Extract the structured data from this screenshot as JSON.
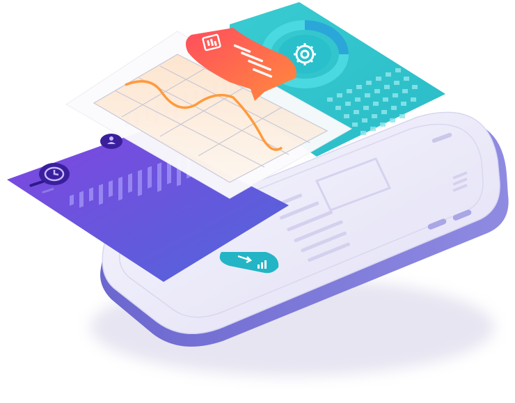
{
  "illustration": {
    "kind": "isometric mobile dashboard illustration",
    "panels": [
      {
        "name": "phone-device",
        "color": "#eceaf8",
        "edge_color": "#7b78d6"
      },
      {
        "name": "teal-analytics-card",
        "color": "#27c2cc",
        "icon": "gear-icon",
        "widget": "donut-ring"
      },
      {
        "name": "purple-stats-card",
        "color": "#6a4ad6",
        "icons": [
          "clock-icon",
          "user-icon"
        ]
      },
      {
        "name": "line-chart-card",
        "color": "#fafafa",
        "curve_color": "#ff9a3c"
      },
      {
        "name": "red-badge",
        "color": "#ff4f5a",
        "icon": "report-icon"
      },
      {
        "name": "teal-pill-button",
        "color": "#23b5c5",
        "icon": "growth-arrow-icon"
      }
    ]
  }
}
